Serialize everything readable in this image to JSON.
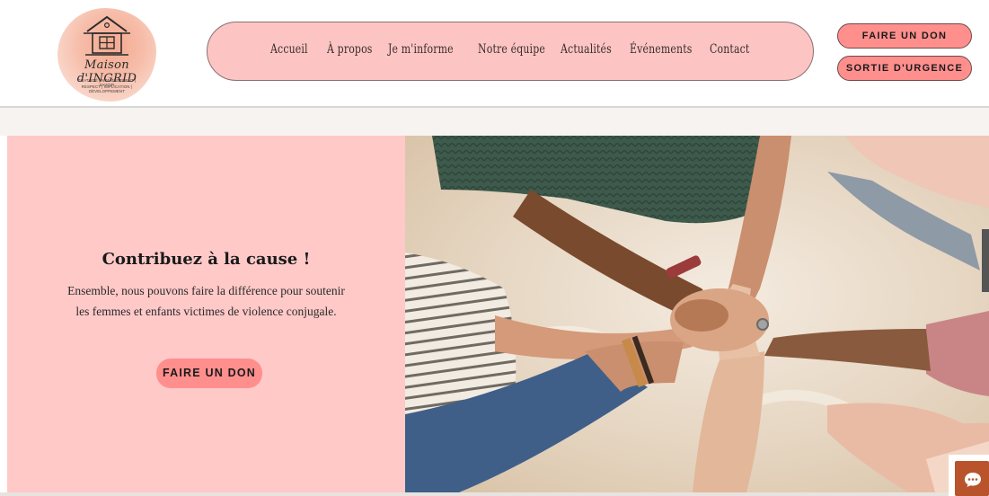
{
  "brand": {
    "name": "Maison d'INGRID",
    "tagline_1": "GRATUITÉ | NON JUGEMENT | SAVOIR",
    "tagline_2": "RESPECT | IMPLICATION | DÉVELOPPEMENT"
  },
  "nav": {
    "items": [
      {
        "label": "Accueil"
      },
      {
        "label": "À propos"
      },
      {
        "label": "Je m'informe"
      },
      {
        "label": "Notre équipe"
      },
      {
        "label": "Actualités"
      },
      {
        "label": "Événements"
      },
      {
        "label": "Contact"
      }
    ]
  },
  "header_buttons": {
    "donate": "FAIRE UN DON",
    "emergency_exit": "SORTIE D'URGENCE"
  },
  "hero": {
    "title": "Contribuez à la cause !",
    "text": "Ensemble, nous pouvons faire la différence pour soutenir les femmes et enfants victimes de violence conjugale.",
    "button": "FAIRE UN DON"
  },
  "icons": {
    "logo": "house-icon",
    "chat": "chat-bubble-icon"
  },
  "colors": {
    "pink_light": "#ffc9c8",
    "pink_button": "#ff8f8d",
    "nav_bg": "#fcc5c3",
    "chat_accent": "#b8532c"
  }
}
